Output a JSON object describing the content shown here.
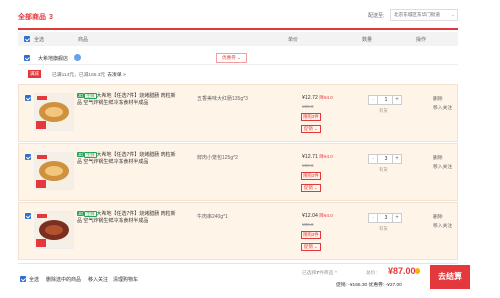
{
  "header": {
    "title": "全部商品",
    "count": "3",
    "ship_label": "配送至:",
    "ship_value": "北京东城区东华门街道"
  },
  "table_head": {
    "select_all": "全选",
    "product": "商品",
    "unit_price": "单价",
    "quantity": "数量",
    "actions": "操作"
  },
  "shop": {
    "name": "大希地旗舰店",
    "coupon": "优惠券"
  },
  "promo": {
    "badge": "满减",
    "text": "已满114元，已减165.3元",
    "link": "去凑单 >"
  },
  "items": [
    {
      "tag_jd": "JD",
      "tag_fresh": "生鲜",
      "name": "大希地【任选7件】烧烤腊肠 肉粒新品 空气炸锅生鲜冷冻食材半成品",
      "spec": "五香美味大红肠135g*3",
      "price": "¥12.72",
      "price_drop": "降¥4.0",
      "orig_price": "¥39.9",
      "limit": "限购3件",
      "promo_dd": "促销",
      "qty": "1",
      "stock": "有货",
      "delete": "删除",
      "favorite": "移入关注"
    },
    {
      "tag_jd": "JD",
      "tag_fresh": "生鲜",
      "name": "大希地【任选7件】烧烤腊肠 肉粒新品 空气炸锅生鲜冷冻食材半成品",
      "spec": "鲜肉小笼包125g*2",
      "price": "¥12.71",
      "price_drop": "降¥4.0",
      "orig_price": "¥39.9",
      "limit": "限购3件",
      "promo_dd": "促销",
      "qty": "3",
      "stock": "有货",
      "delete": "删除",
      "favorite": "移入关注"
    },
    {
      "tag_jd": "JD",
      "tag_fresh": "生鲜",
      "name": "大希地【任选7件】烧烤腊肠 肉粒新品 空气炸锅生鲜冷冻食材半成品",
      "spec": "牛肉串240g*1",
      "price": "¥12.04",
      "price_drop": "降¥4.0",
      "orig_price": "¥39.9",
      "limit": "限购3件",
      "promo_dd": "促销",
      "qty": "3",
      "stock": "有货",
      "delete": "删除",
      "favorite": "移入关注"
    }
  ],
  "footer": {
    "select_all": "全选",
    "delete_selected": "删除选中的商品",
    "move_fav": "移入关注",
    "clear_cart": "清理购物车",
    "selected_prefix": "已选择",
    "selected_count": "7",
    "selected_suffix": "件商品 ^",
    "total_label": "总价:",
    "total": "¥87.00",
    "savings": "促销: -¥165.30 优惠券: -¥27.00",
    "checkout": "去结算"
  },
  "colors": {
    "accent": "#e4393c",
    "checkbox": "#2f6fd0",
    "item_bg": "#fff4e8",
    "fresh_tag": "#25a55c"
  }
}
